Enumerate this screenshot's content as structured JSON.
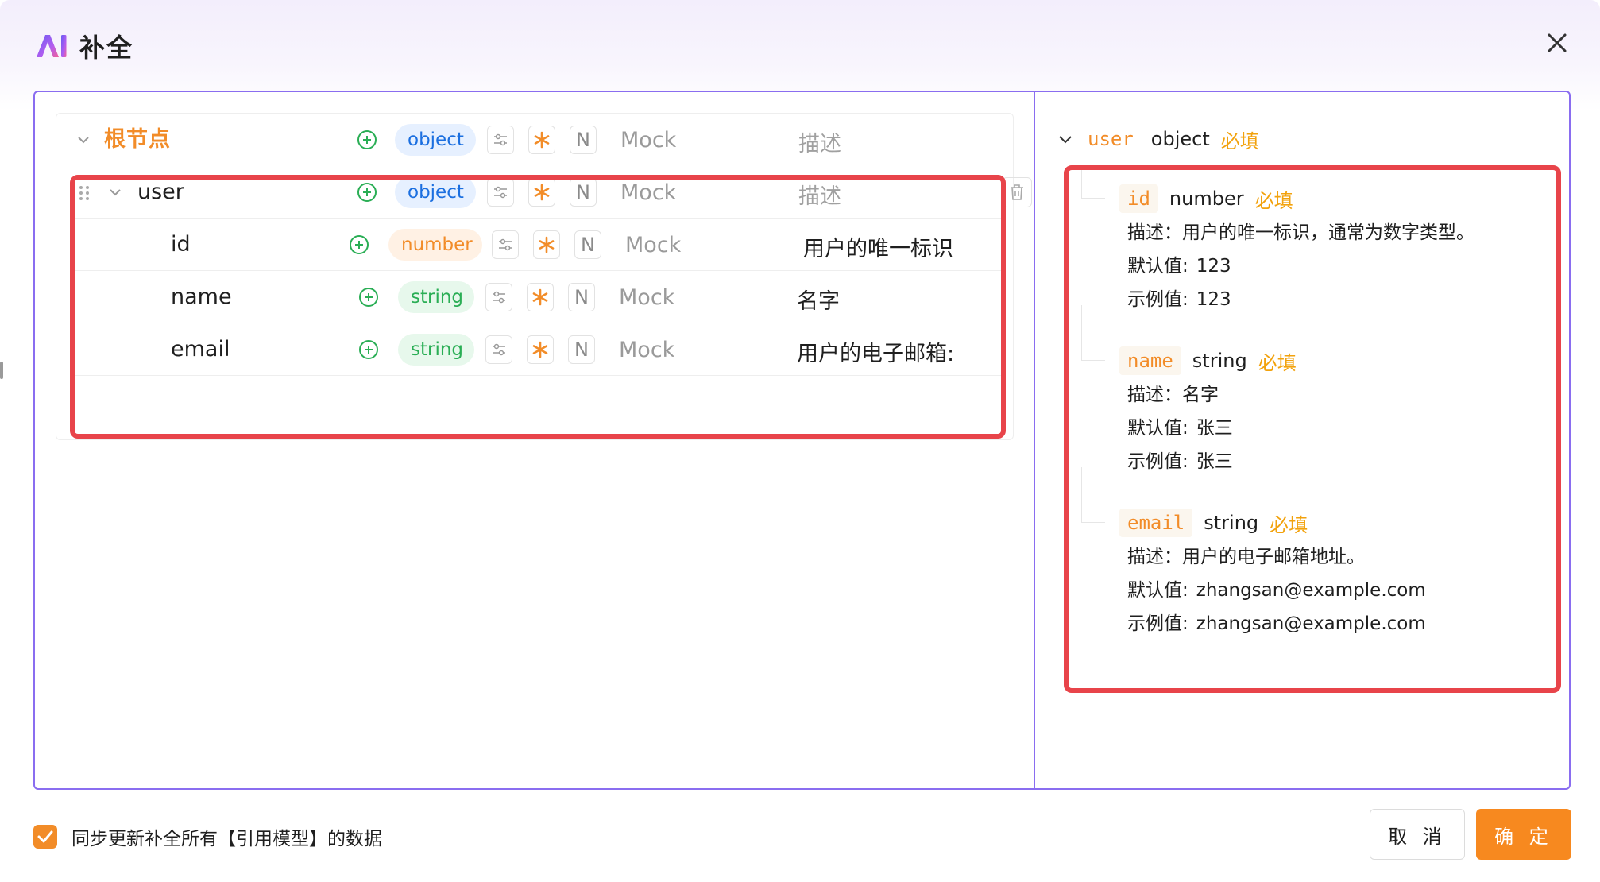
{
  "header": {
    "title": "补全",
    "logo_text": "AI"
  },
  "tree": {
    "rows": [
      {
        "name": "根节点",
        "type": "object",
        "mock": "Mock",
        "desc": "描述",
        "desc_placeholder": true
      },
      {
        "name": "user",
        "type": "object",
        "mock": "Mock",
        "desc": "描述",
        "desc_placeholder": true
      },
      {
        "name": "id",
        "type": "number",
        "mock": "Mock",
        "desc": "用户的唯一标识",
        "desc_placeholder": false
      },
      {
        "name": "name",
        "type": "string",
        "mock": "Mock",
        "desc": "名字",
        "desc_placeholder": false
      },
      {
        "name": "email",
        "type": "string",
        "mock": "Mock",
        "desc": "用户的电子邮箱:",
        "desc_placeholder": false
      }
    ],
    "nullable_label": "N"
  },
  "preview": {
    "root": {
      "key": "user",
      "type": "object",
      "required": "必填"
    },
    "desc_label": "描述：",
    "default_label": "默认值:",
    "example_label": "示例值:",
    "fields": [
      {
        "key": "id",
        "type": "number",
        "required": "必填",
        "desc": "用户的唯一标识，通常为数字类型。",
        "default": "123",
        "example": "123"
      },
      {
        "key": "name",
        "type": "string",
        "required": "必填",
        "desc": "名字",
        "default": "张三",
        "example": "张三"
      },
      {
        "key": "email",
        "type": "string",
        "required": "必填",
        "desc": "用户的电子邮箱地址。",
        "default": "zhangsan@example.com",
        "example": "zhangsan@example.com"
      }
    ]
  },
  "footer": {
    "sync_label": "同步更新补全所有【引用模型】的数据",
    "sync_checked": true,
    "cancel_label": "取 消",
    "ok_label": "确 定"
  },
  "colors": {
    "accent": "#f7891f",
    "frame": "#8a6df0",
    "highlight": "#e8444a",
    "add": "#2aae55"
  }
}
